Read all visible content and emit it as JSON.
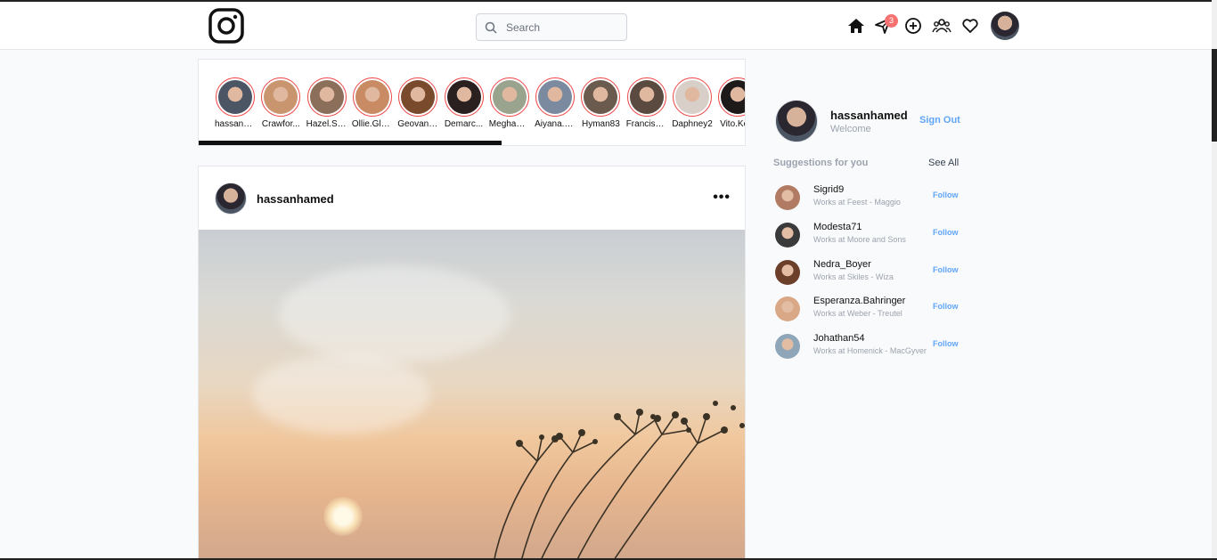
{
  "header": {
    "search_placeholder": "Search",
    "messages_badge": "3"
  },
  "stories": [
    {
      "name": "hassanh...",
      "color": "#4b5563"
    },
    {
      "name": "Crawfor...",
      "color": "#c9956f"
    },
    {
      "name": "Hazel.Sa...",
      "color": "#8b6f5b"
    },
    {
      "name": "Ollie.Glei...",
      "color": "#c98b63"
    },
    {
      "name": "Geovann...",
      "color": "#7a4a2c"
    },
    {
      "name": "Demarc...",
      "color": "#2b2020"
    },
    {
      "name": "Meghan....",
      "color": "#9aa38e"
    },
    {
      "name": "Aiyana.C...",
      "color": "#7c8aa0"
    },
    {
      "name": "Hyman83",
      "color": "#6b5a4e"
    },
    {
      "name": "Francis_...",
      "color": "#5a4a40"
    },
    {
      "name": "Daphney2",
      "color": "#d8d0c8"
    },
    {
      "name": "Vito.Ko...",
      "color": "#1f1a1a"
    }
  ],
  "post": {
    "username": "hassanhamed",
    "more_label": "•••"
  },
  "profile": {
    "username": "hassanhamed",
    "subtitle": "Welcome",
    "sign_out_label": "Sign Out"
  },
  "suggestions": {
    "title": "Suggestions for you",
    "see_all_label": "See All",
    "items": [
      {
        "name": "Sigrid9",
        "work": "Works at Feest - Maggio",
        "follow": "Follow",
        "color": "#b07a63"
      },
      {
        "name": "Modesta71",
        "work": "Works at Moore and Sons",
        "follow": "Follow",
        "color": "#3a3a3a"
      },
      {
        "name": "Nedra_Boyer",
        "work": "Works at Skiles - Wiza",
        "follow": "Follow",
        "color": "#6b3f2a"
      },
      {
        "name": "Esperanza.Bahringer",
        "work": "Works at Weber - Treutel",
        "follow": "Follow",
        "color": "#d9a886"
      },
      {
        "name": "Johathan54",
        "work": "Works at Homenick - MacGyver",
        "follow": "Follow",
        "color": "#8fa6b8"
      }
    ]
  }
}
